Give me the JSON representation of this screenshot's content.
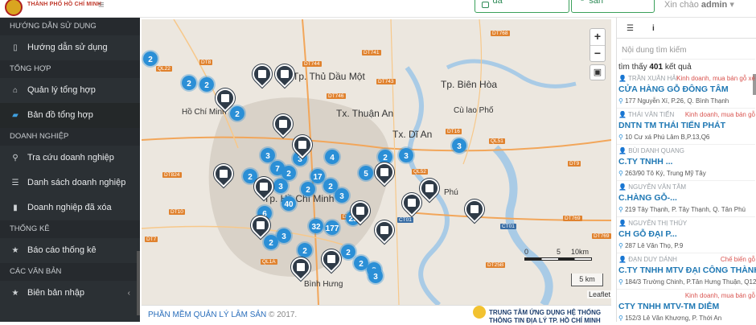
{
  "header": {
    "brand": "THÀNH PHỐ HỒ CHÍ MINH",
    "btn1": "Động vật hoang dã",
    "btn2": "Quản lý lâm sản",
    "greet_prefix": "Xin chào",
    "greet_user": "admin"
  },
  "sidebar": {
    "sections": [
      {
        "title": "HƯỚNG DẪN SỬ DỤNG",
        "items": [
          {
            "label": "Hướng dẫn sử dụng",
            "icon": "file-icon"
          }
        ]
      },
      {
        "title": "TỔNG HỢP",
        "items": [
          {
            "label": "Quản lý tổng hợp",
            "icon": "home-icon"
          },
          {
            "label": "Bản đồ tổng hợp",
            "icon": "map-icon"
          }
        ]
      },
      {
        "title": "DOANH NGHIỆP",
        "items": [
          {
            "label": "Tra cứu doanh nghiệp",
            "icon": "search-icon"
          },
          {
            "label": "Danh sách doanh nghiệp",
            "icon": "database-icon"
          },
          {
            "label": "Doanh nghiệp đã xóa",
            "icon": "trash-icon"
          }
        ]
      },
      {
        "title": "THỐNG KÊ",
        "items": [
          {
            "label": "Báo cáo thống kê",
            "icon": "star-icon"
          }
        ]
      },
      {
        "title": "CÁC VĂN BẢN",
        "items": [
          {
            "label": "Biên bản nhập",
            "icon": "star-icon"
          }
        ]
      }
    ]
  },
  "map": {
    "labels": [
      "Tp. Thủ Dầu Một",
      "Tp. Biên Hòa",
      "Tx. Thuận An",
      "Tx. Dĩ An",
      "Cù lao Phố",
      "Tp. Hồ Chí Minh",
      "Hồ Chí Minh",
      "Bình Hưng",
      "Phú"
    ],
    "clusters": [
      "2",
      "2",
      "2",
      "2",
      "3",
      "3",
      "3",
      "3",
      "4",
      "7",
      "17",
      "2",
      "2",
      "2",
      "5",
      "3",
      "2",
      "2",
      "3",
      "40",
      "6",
      "32",
      "177",
      "23",
      "3",
      "2",
      "2",
      "2",
      "2",
      "2",
      "3"
    ],
    "roads": [
      "QL22",
      "DT8",
      "DT744",
      "DT741",
      "DT768",
      "DT743",
      "DT746",
      "DT824",
      "DT10",
      "DT7",
      "QL1A",
      "QL51",
      "QL52",
      "DT16",
      "CT01",
      "DT769",
      "DT25B",
      "DT769",
      "DT9",
      "DT11",
      "CT01"
    ],
    "scale_0": "0",
    "scale_5": "5",
    "scale_10": "10km",
    "scale_small": "5 km",
    "attribution": "Leaflet",
    "zoom_in": "+",
    "zoom_out": "−"
  },
  "footer": {
    "app_name": "PHẦN MỀM QUẢN LÝ LÂM SẢN",
    "copyright": " © 2017.",
    "org_line1": "TRUNG TÂM ỨNG DỤNG HỆ THỐNG",
    "org_line2": "THÔNG TIN ĐỊA LÝ TP. HỒ CHÍ MINH"
  },
  "panel": {
    "search_placeholder": "Nội dung tìm kiếm",
    "count_prefix": "tìm thấy",
    "count_value": "401",
    "count_suffix": "kết quả",
    "results": [
      {
        "owner": "TRẦN XUÂN HẢI",
        "tag": "Kinh doanh, mua bán gỗ xẻ",
        "name": "CỬA HÀNG GỖ ĐÔNG TÂM",
        "address": "177 Nguyễn Xí, P.26, Q. Bình Thạnh"
      },
      {
        "owner": "THÁI VĂN TIẾN",
        "tag": "Kinh doanh, mua bán gỗ",
        "name": "DNTN TM THÁI TIẾN PHÁT",
        "address": "10 Cư xá Phú Lâm B,P.13,Q6"
      },
      {
        "owner": "BÙI DANH QUANG",
        "tag": "",
        "name": "C.TY TNHH ...",
        "address": "263/90 Tô Ký, Trung Mỹ Tây"
      },
      {
        "owner": "NGUYỄN VĂN TÂM",
        "tag": "",
        "name": "C.HÀNG GỖ-...",
        "address": "219 Tây Thạnh, P. Tây Thạnh, Q. Tân Phú"
      },
      {
        "owner": "NGUYỄN THỊ THÚY",
        "tag": "",
        "name": "CH GỖ ĐẠI P...",
        "address": "287 Lê Văn Thọ, P.9"
      },
      {
        "owner": "ĐẠN DUY DÁNH",
        "tag": "Chế biến gỗ",
        "name": "C.TY TNHH MTV ĐẠI CÔNG THÀNH",
        "address": "184/3 Trường Chinh, P.Tân Hưng Thuận, Q12"
      },
      {
        "owner": "",
        "tag": "Kinh doanh, mua bán gỗ",
        "name": "CTY TNHH MTV-TM DIỄM",
        "address": "152/3 Lê Văn Khương, P. Thới An"
      }
    ]
  }
}
